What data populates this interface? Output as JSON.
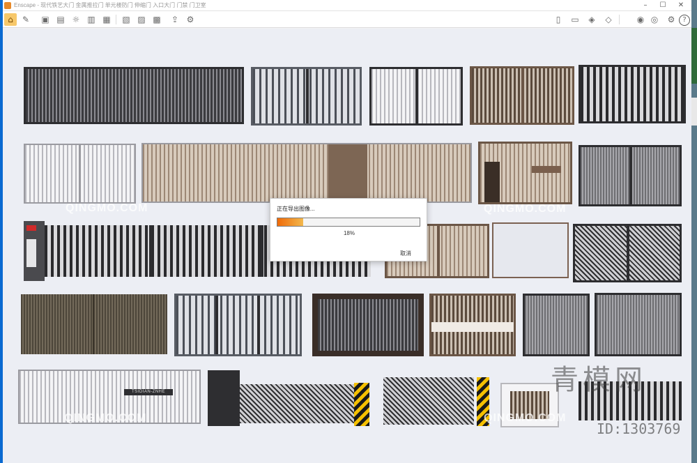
{
  "window": {
    "title": "Enscape - 现代铁艺大门 金属推拉门 单元楼防门 伸缩门 入口大门 门禁 门卫室",
    "minimize": "–",
    "maximize": "☐",
    "close": "✕"
  },
  "toolbar": {
    "left_icons": [
      "home-icon",
      "tool-icon",
      "camera-icon",
      "save-icon",
      "sun-icon",
      "asset-icon",
      "building-icon",
      "render-icon",
      "screenshot-icon",
      "batch-icon",
      "panorama-icon",
      "export-icon",
      "settings-icon"
    ],
    "right_icons": [
      "book-icon",
      "video-icon",
      "cube-icon",
      "chat-icon",
      "vr-icon",
      "eye-icon",
      "settings-gear-icon",
      "help-icon"
    ],
    "help_label": "?"
  },
  "dialog": {
    "title": "正在导出图像...",
    "progress_percent": 18,
    "percent_text": "18%",
    "cancel_label": "取消",
    "progress_colors": [
      "#ef6a08",
      "#f2b84d"
    ]
  },
  "gates": {
    "plaque_text": "TSIDIAN-ZNHE"
  },
  "watermarks": {
    "qingmo": "QINGMO.COM",
    "brand_cn": "青模网",
    "id_label": "ID:1303769"
  }
}
